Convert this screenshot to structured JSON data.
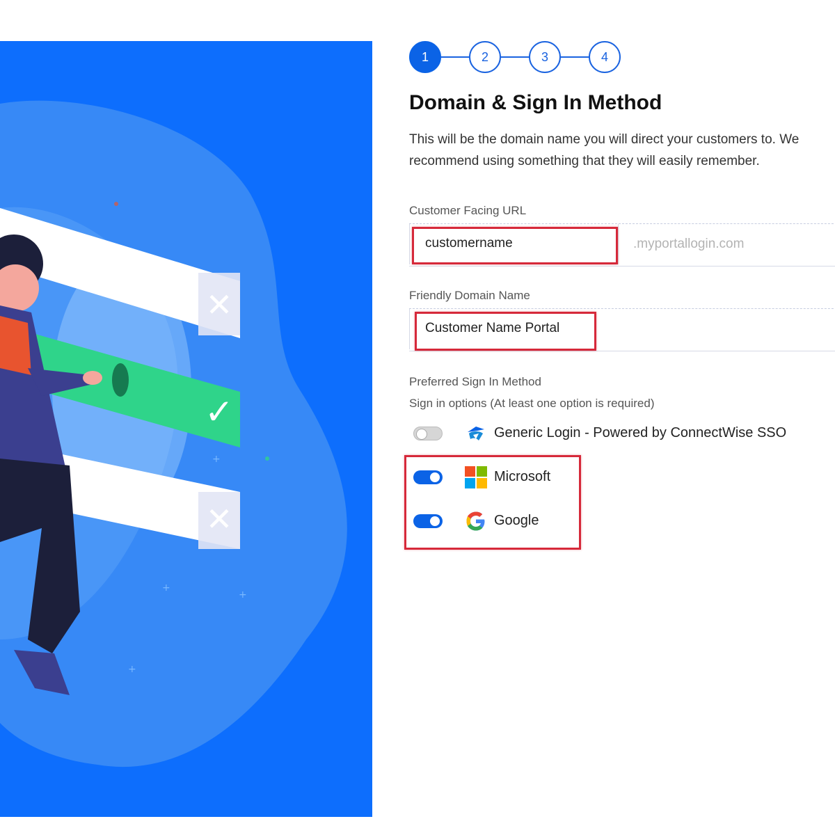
{
  "colors": {
    "accent": "#0b63e6",
    "hero_bg": "#0d6efd",
    "highlight": "#d6293a",
    "success": "#2fd48a"
  },
  "stepper": {
    "steps": [
      {
        "label": "1",
        "active": true
      },
      {
        "label": "2",
        "active": false
      },
      {
        "label": "3",
        "active": false
      },
      {
        "label": "4",
        "active": false
      }
    ]
  },
  "page": {
    "title": "Domain & Sign In Method",
    "description": "This will be the domain name you will direct your customers to. We recommend using something that they will easily remember."
  },
  "url_field": {
    "label": "Customer Facing URL",
    "value": "customername",
    "suffix": ".myportallogin.com"
  },
  "friendly_field": {
    "label": "Friendly Domain Name",
    "value": "Customer Name Portal"
  },
  "sign_in": {
    "section_label": "Preferred Sign In Method",
    "hint": "Sign in options (At least one option is required)",
    "options": [
      {
        "label": "Generic Login - Powered by ConnectWise SSO",
        "enabled": false,
        "icon": "connectwise-icon"
      },
      {
        "label": "Microsoft",
        "enabled": true,
        "icon": "microsoft-icon"
      },
      {
        "label": "Google",
        "enabled": true,
        "icon": "google-icon"
      }
    ]
  }
}
